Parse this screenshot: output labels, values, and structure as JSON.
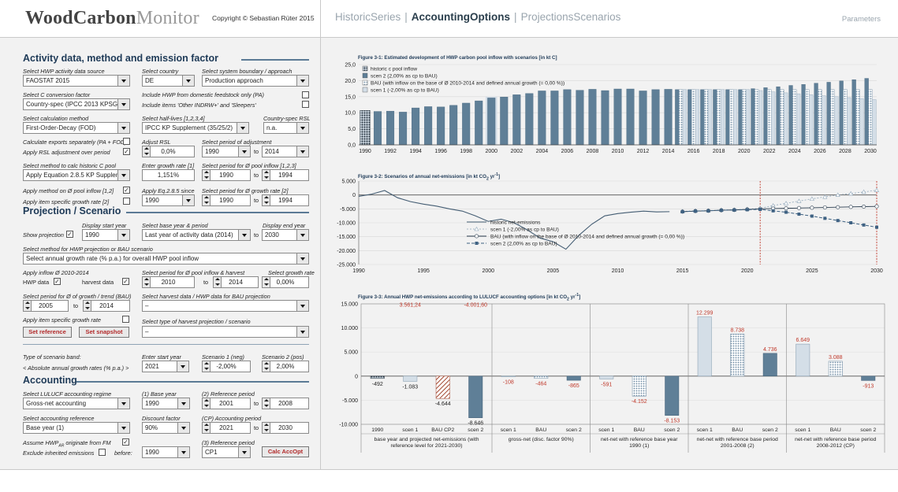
{
  "header": {
    "logo_wood": "Wood",
    "logo_carbon": "Carbon",
    "logo_monitor": "Monitor",
    "copyright": "Copyright © Sebastian Rüter 2015",
    "tabs": [
      "HistoricSeries",
      "AccountingOptions",
      "ProjectionsScenarios"
    ],
    "separator": "|",
    "active_tab": "AccountingOptions",
    "parameters": "Parameters"
  },
  "activity": {
    "title": "Activity data, method and emission factor",
    "hwp_source_label": "Select HWP activity data source",
    "hwp_source_value": "FAOSTAT 2015",
    "country_label": "Select country",
    "country_value": "DE",
    "boundary_label": "Select system boundary / approach",
    "boundary_value": "Production approach",
    "cconv_label": "Select C conversion factor",
    "cconv_value": "Country-spec (IPCC 2013 KPSG)",
    "domestic_label": "Include HWP from domestic feedstock only (PA)",
    "other_label": "Include items 'Other INDRW+' and 'Sleepers'",
    "calc_label": "Select calculation method",
    "calc_value": "First-Order-Decay (FOD)",
    "halflives_label": "Select half-lives [1,2,3,4]",
    "halflives_value": "IPCC KP Supplement (35/25/2)",
    "rsl_label": "Country-spec RSL",
    "rsl_value": "n.a.",
    "exports_label": "Calculate exports separately (PA + FOD)",
    "rsladj_label": "Apply RSL adjustment over period",
    "adjrsl_label": "Adjust RSL",
    "adjrsl_value": "0,0%",
    "period_adj_label": "Select period of adjustment",
    "period_adj_from": "1990",
    "period_adj_to": "2014",
    "to": "to",
    "histc_label": "Select method to calc historic C pool",
    "histc_value": "Apply Equation 2.8.5 KP Supplement",
    "growth_label": "Enter growth rate [1]",
    "growth_value": "1,151%",
    "poolperiod_label": "Select period for Ø pool inflow [1,2,3]",
    "poolperiod_from": "1990",
    "poolperiod_to": "1994",
    "applyinflow_label": "Apply method on Ø pool inflow [1,2]",
    "applyeq_label": "Apply Eq.2.8.5 since",
    "applyeq_value": "1990",
    "growthperiod_label": "Select period for Ø growth rate [2]",
    "growthperiod_from": "1990",
    "growthperiod_to": "1994",
    "itemgrowth_label": "Apply item specific growth rate [2]"
  },
  "projection": {
    "title": "Projection / Scenario",
    "display_start_label": "Display start year",
    "show_label": "Show projection",
    "display_start_value": "1990",
    "base_label": "Select base year & period",
    "base_value": "Last year of activity data (2014)",
    "display_end_label": "Display end year",
    "to": "to",
    "display_end_value": "2030",
    "method_label": "Select method for HWP projection or BAU scenario",
    "method_value": "Select annual growth rate (% p.a.) for overall HWP pool inflow",
    "inflow_label": "Apply inflow Ø 2010-2014",
    "hwp_data": "HWP data",
    "harvest_data": "harvest data",
    "period_inflow_label": "Select period for Ø pool inflow & harvest",
    "period_inflow_from": "2010",
    "period_inflow_to": "2014",
    "sel_growth_label": "Select growth rate",
    "sel_growth_value": "0,00%",
    "period_growth_label": "Select period for Ø of growth / trend (BAU)",
    "period_growth_from": "2005",
    "period_growth_to": "2014",
    "harvest_label": "Select harvest data / HWP data for BAU projection",
    "harvest_value": "–",
    "item_growth_label": "Apply item specific growth rate",
    "harvproj_label": "Select type of harvest projection / scenario",
    "harvproj_value": "–",
    "set_reference": "Set reference",
    "set_snapshot": "Set snapshot",
    "band_label": "Type of scenario band:",
    "band_value": "< Absolute annual growth rates (% p.a.) >",
    "start_label": "Enter start year",
    "start_value": "2021",
    "sc1_label": "Scenario 1 (neg)",
    "sc1_value": "-2,00%",
    "sc2_label": "Scenario 2 (pos)",
    "sc2_value": "2,00%"
  },
  "accounting": {
    "title": "Accounting",
    "regime_label": "Select LULUCF accounting regime",
    "regime_value": "Gross-net accounting",
    "base_label": "(1) Base year",
    "base_value": "1990",
    "ref_label": "(2) Reference period",
    "ref_from": "2001",
    "ref_to": "2008",
    "to": "to",
    "accref_label": "Select accounting reference",
    "accref_value": "Base year (1)",
    "disc_label": "Discount factor",
    "disc_value": "90%",
    "cp_label": "(CP) Accounting period",
    "cp_from": "2021",
    "cp_to": "2030",
    "assume_label_pre": "Assume HWP",
    "assume_label_sub": "AR",
    "assume_label_post": "originate from FM",
    "excl_label": "Exclude inherited emissions",
    "before_label": "before:",
    "before_value": "1990",
    "ref3_label": "(3) Reference period",
    "ref3_value": "CP1",
    "calc_button": "Calc AccOpt"
  },
  "figures": {
    "fig1_title": "Figure 3-1: Estimated development of HWP carbon pool inflow with scenarios [in kt C]",
    "fig2_title_pre": "Figure 3-2: Scenarios of annual net-emissions [in kt CO",
    "fig2_title_sub": "2",
    "fig2_title_mid": " yr",
    "fig2_title_sup": "-1",
    "fig2_title_post": "]",
    "fig3_title_pre": "Figure 3-3: Annual HWP net-emissions according to LULUCF accounting options [in kt CO",
    "fig3_title_sub": "2",
    "fig3_title_mid": " yr",
    "fig3_title_sup": "-1",
    "fig3_title_post": "]"
  },
  "chart_data": [
    {
      "type": "bar",
      "title": "Figure 3-1: Estimated development of HWP carbon pool inflow with scenarios [in kt C]",
      "x": [
        1990,
        1991,
        1992,
        1993,
        1994,
        1995,
        1996,
        1997,
        1998,
        1999,
        2000,
        2001,
        2002,
        2003,
        2004,
        2005,
        2006,
        2007,
        2008,
        2009,
        2010,
        2011,
        2012,
        2013,
        2014,
        2015,
        2016,
        2017,
        2018,
        2019,
        2020,
        2021,
        2022,
        2023,
        2024,
        2025,
        2026,
        2027,
        2028,
        2029,
        2030
      ],
      "xticks": [
        1990,
        1992,
        1994,
        1996,
        1998,
        2000,
        2002,
        2004,
        2006,
        2008,
        2010,
        2012,
        2014,
        2016,
        2018,
        2020,
        2022,
        2024,
        2026,
        2028,
        2030
      ],
      "ylim": [
        0,
        25
      ],
      "yticks": [
        "0,0",
        "5,0",
        "10,0",
        "15,0",
        "20,0",
        "25,0"
      ],
      "legend": [
        "historic c pool inflow",
        "scen 2 (2,00% as cp to BAU)",
        "BAU (with inflow on the base of Ø 2010-2014 and defined annual growth (= 0,00 %))",
        "scen 1 (-2,00% as cp to BAU)"
      ],
      "series": [
        {
          "name": "historic c pool inflow",
          "values": [
            10.7,
            null,
            null,
            null,
            null,
            null,
            null,
            null,
            null,
            null,
            null,
            null,
            null,
            null,
            null,
            null,
            null,
            null,
            null,
            null,
            null,
            null,
            null,
            null,
            null,
            null,
            null,
            null,
            null,
            null,
            null,
            null,
            null,
            null,
            null,
            null,
            null,
            null,
            null,
            null,
            null
          ]
        },
        {
          "name": "scen 2 (2,00% as cp to BAU)",
          "values": [
            null,
            10.4,
            10.5,
            10.2,
            11.5,
            11.9,
            11.8,
            12.3,
            13.0,
            13.7,
            14.6,
            14.9,
            15.6,
            16.0,
            16.8,
            16.8,
            17.2,
            17.0,
            17.3,
            16.9,
            17.4,
            17.4,
            16.8,
            17.2,
            17.3,
            17.2,
            17.2,
            17.2,
            17.2,
            17.2,
            17.2,
            17.5,
            17.8,
            18.1,
            18.5,
            18.8,
            19.2,
            19.5,
            19.9,
            20.3,
            20.7
          ]
        },
        {
          "name": "BAU (with inflow on the base of Ø 2010-2014 and defined annual growth (= 0,00 %))",
          "values": [
            null,
            null,
            null,
            null,
            null,
            null,
            null,
            null,
            null,
            null,
            null,
            null,
            null,
            null,
            null,
            null,
            null,
            null,
            null,
            null,
            null,
            null,
            null,
            null,
            null,
            17.2,
            17.2,
            17.2,
            17.2,
            17.2,
            17.2,
            17.2,
            17.2,
            17.2,
            17.2,
            17.2,
            17.2,
            17.2,
            17.2,
            17.2,
            17.2
          ]
        },
        {
          "name": "scen 1 (-2,00% as cp to BAU)",
          "values": [
            null,
            null,
            null,
            null,
            null,
            null,
            null,
            null,
            null,
            null,
            15.0,
            null,
            null,
            null,
            null,
            null,
            null,
            null,
            null,
            null,
            null,
            null,
            null,
            null,
            null,
            17.2,
            17.2,
            17.2,
            17.2,
            17.2,
            17.2,
            16.9,
            16.5,
            16.2,
            15.9,
            15.6,
            15.3,
            15.0,
            14.7,
            14.4,
            14.1
          ]
        }
      ]
    },
    {
      "type": "line",
      "title": "Figure 3-2: Scenarios of annual net-emissions [in kt CO2 yr-1]",
      "ylim": [
        -25000,
        5000
      ],
      "yticks": [
        "5.000",
        "0",
        "-5.000",
        "-10.000",
        "-15.000",
        "-20.000",
        "-25.000"
      ],
      "xticks": [
        1990,
        1995,
        2000,
        2005,
        2010,
        2015,
        2020,
        2025,
        2030
      ],
      "xlim": [
        1990,
        2030
      ],
      "vlines": [
        2021,
        2030
      ],
      "legend": [
        "historic net-emissions",
        "scen 1 (-2,00% as cp to BAU)",
        "BAU (with inflow on the base of Ø 2010-2014 and defined annual growth (= 0,00 %))",
        "scen 2 (2,00% as cp to BAU)"
      ],
      "series": [
        {
          "name": "historic net-emissions",
          "x": [
            1990,
            1991,
            1992,
            1993,
            1994,
            1995,
            1996,
            1997,
            1998,
            1999,
            2000,
            2001,
            2002,
            2003,
            2004,
            2005,
            2006,
            2007,
            2008,
            2009,
            2010,
            2011,
            2012,
            2013,
            2014
          ],
          "y": [
            -500,
            300,
            1600,
            -1000,
            -2400,
            -3300,
            -4000,
            -5000,
            -5800,
            -7500,
            -9500,
            -8700,
            -10000,
            -12500,
            -15500,
            -16800,
            -19500,
            -14500,
            -10500,
            -7500,
            -6700,
            -6200,
            -5800,
            -6100,
            -6000
          ]
        },
        {
          "name": "scen 1 (-2,00% as cp to BAU)",
          "x": [
            2015,
            2016,
            2017,
            2018,
            2019,
            2020,
            2021,
            2022,
            2023,
            2024,
            2025,
            2026,
            2027,
            2028,
            2029,
            2030
          ],
          "y": [
            -5900,
            -5700,
            -5600,
            -5400,
            -5300,
            -5100,
            -4800,
            -3800,
            -3000,
            -2200,
            -1400,
            -700,
            0,
            500,
            1100,
            1700
          ]
        },
        {
          "name": "BAU (with inflow on the base of Ø 2010-2014 and defined annual growth (= 0,00 %))",
          "x": [
            2015,
            2016,
            2017,
            2018,
            2019,
            2020,
            2021,
            2022,
            2023,
            2024,
            2025,
            2026,
            2027,
            2028,
            2029,
            2030
          ],
          "y": [
            -6000,
            -5800,
            -5700,
            -5500,
            -5400,
            -5200,
            -5000,
            -4900,
            -4800,
            -4700,
            -4600,
            -4500,
            -4400,
            -4300,
            -4200,
            -4100
          ]
        },
        {
          "name": "scen 2 (2,00% as cp to BAU)",
          "x": [
            2015,
            2016,
            2017,
            2018,
            2019,
            2020,
            2021,
            2022,
            2023,
            2024,
            2025,
            2026,
            2027,
            2028,
            2029,
            2030
          ],
          "y": [
            -6000,
            -5800,
            -5700,
            -5500,
            -5400,
            -5300,
            -5200,
            -5700,
            -6200,
            -6900,
            -7600,
            -8400,
            -9200,
            -10000,
            -10800,
            -11600
          ]
        }
      ]
    },
    {
      "type": "bar",
      "title": "Figure 3-3: Annual HWP net-emissions according to LULUCF accounting options [in kt CO2 yr-1]",
      "ylim": [
        -10000,
        15000
      ],
      "yticks": [
        "15.000",
        "10.000",
        "5.000",
        "0",
        "-5.000",
        "-10.000"
      ],
      "groups": [
        {
          "name": "base year and projected net-emissions (with reference level for 2021-2030)",
          "bars": [
            {
              "label": "1990",
              "value": -492,
              "text": "-492",
              "style": "hist"
            },
            {
              "label": "scen 1",
              "value": -1083,
              "text": "-1.083",
              "style": "scen1",
              "top": "3.561,24"
            },
            {
              "label": "BAU CP2",
              "value": -4644,
              "text": "-4.644",
              "style": "hatch"
            },
            {
              "label": "scen 2",
              "value": -8646,
              "text": "-8.646",
              "style": "scen2",
              "top": "-4.001,60"
            }
          ]
        },
        {
          "name": "gross-net (disc. factor 90%)",
          "bars": [
            {
              "label": "scen 1",
              "value": -108,
              "text": "-108",
              "style": "scen1"
            },
            {
              "label": "BAU",
              "value": -464,
              "text": "-464",
              "style": "bau"
            },
            {
              "label": "scen 2",
              "value": -865,
              "text": "-865",
              "style": "scen2"
            }
          ]
        },
        {
          "name": "net-net with reference base year 1990 (1)",
          "bars": [
            {
              "label": "scen 1",
              "value": -591,
              "text": "-591",
              "style": "scen1"
            },
            {
              "label": "BAU",
              "value": -4152,
              "text": "-4.152",
              "style": "bau"
            },
            {
              "label": "scen 2",
              "value": -8153,
              "text": "-8.153",
              "style": "scen2"
            }
          ]
        },
        {
          "name": "net-net with reference base period 2001-2008 (2)",
          "bars": [
            {
              "label": "scen 1",
              "value": 12299,
              "text": "12.299",
              "style": "scen1"
            },
            {
              "label": "BAU",
              "value": 8738,
              "text": "8.738",
              "style": "bau"
            },
            {
              "label": "scen 2",
              "value": 4736,
              "text": "4.736",
              "style": "scen2"
            }
          ]
        },
        {
          "name": "net-net with reference base period 2008-2012 (CP)",
          "bars": [
            {
              "label": "scen 1",
              "value": 6649,
              "text": "6.649",
              "style": "scen1"
            },
            {
              "label": "BAU",
              "value": 3088,
              "text": "3.088",
              "style": "bau"
            },
            {
              "label": "scen 2",
              "value": -913,
              "text": "-913",
              "style": "scen2"
            }
          ]
        }
      ]
    }
  ]
}
